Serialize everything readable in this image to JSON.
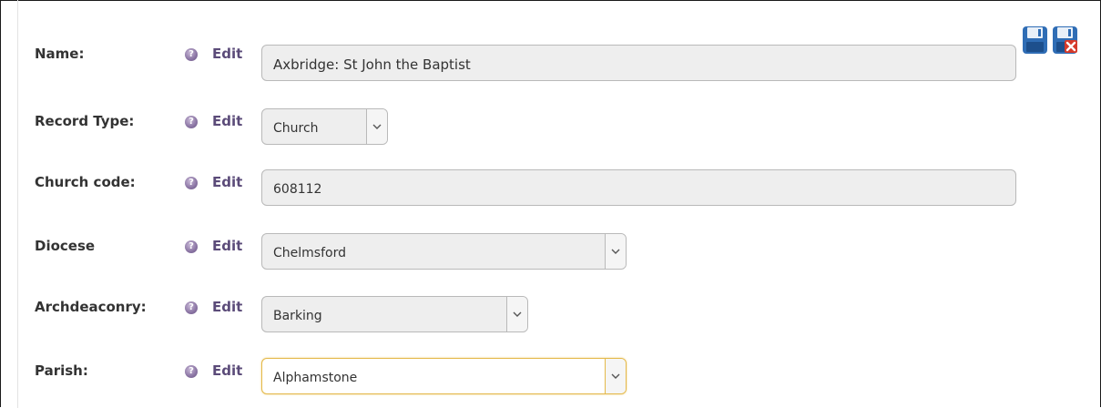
{
  "toolbar": {
    "save_icon": "save-icon",
    "save_cancel_icon": "save-cancel-icon"
  },
  "help_glyph": "?",
  "fields": [
    {
      "label": "Name:",
      "edit": "Edit",
      "value": "Axbridge: St John the Baptist",
      "kind": "text"
    },
    {
      "label": "Record Type:",
      "edit": "Edit",
      "value": "Church",
      "kind": "select"
    },
    {
      "label": "Church code:",
      "edit": "Edit",
      "value": "608112",
      "kind": "text"
    },
    {
      "label": "Diocese",
      "edit": "Edit",
      "value": "Chelmsford",
      "kind": "select"
    },
    {
      "label": "Archdeaconry:",
      "edit": "Edit",
      "value": "Barking",
      "kind": "select"
    },
    {
      "label": "Parish:",
      "edit": "Edit",
      "value": "Alphamstone",
      "kind": "select",
      "focused": true
    }
  ],
  "colors": {
    "edit_link": "#5b4b79",
    "field_bg": "#eeeeee",
    "focus_border": "#e4b94a",
    "save_icon_blue": "#2f6db5",
    "cancel_red": "#d63a2a"
  }
}
